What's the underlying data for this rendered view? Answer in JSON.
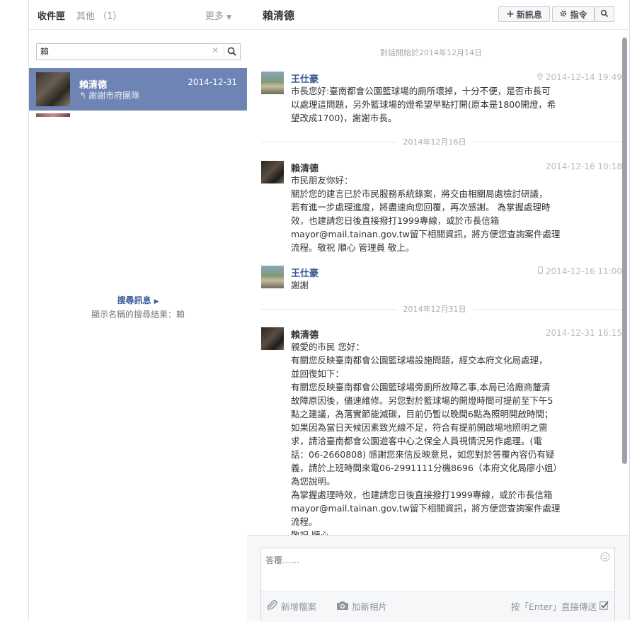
{
  "left_panel": {
    "tab_inbox": "收件匣",
    "tab_other": "其他 （1）",
    "more_label": "更多",
    "search_value": "賴",
    "conversations": [
      {
        "name": "賴清德",
        "date": "2014-12-31",
        "snippet": "謝謝市府團隊"
      }
    ],
    "search_more_label": "搜尋訊息",
    "search_result_text": "顯示名稱的搜尋結果：賴"
  },
  "header": {
    "title": "賴清德",
    "new_message_label": "新訊息",
    "actions_label": "指令"
  },
  "thread": {
    "start_text": "對話開始於2014年12月14日",
    "dividers": [
      "2014年12月16日",
      "2014年12月31日"
    ],
    "messages": [
      {
        "sender": "王仕豪",
        "time": "2014-12-14 19:49",
        "source_icon": "location-pin-icon",
        "lines": [
          "市長您好:臺南都會公園籃球場的廁所壞掉，十分不便，是否市長可",
          "以處理這問題，另外籃球場的燈希望早點打開(原本是1800開燈，希",
          "望改成1700)，謝謝市長。"
        ]
      },
      {
        "sender": "賴清德",
        "time": "2014-12-16 10:18",
        "lines": [
          "市民朋友你好：",
          "關於您的建言已於市民服務系統錄案，將交由相關局處檢討研議，",
          "若有進一步處理進度，將盡速向您回覆，再次感謝。 為掌握處理時",
          "效，也建請您日後直接撥打1999專線，或於市長信箱",
          "mayor@mail.tainan.gov.tw留下相關資訊，將方便您查詢案件處理",
          "流程。敬祝 順心 管理員 敬上。"
        ]
      },
      {
        "sender": "王仕豪",
        "time": "2014-12-16 11:00",
        "source_icon": "mobile-phone-icon",
        "lines": [
          "謝謝"
        ]
      },
      {
        "sender": "賴清德",
        "time": "2014-12-31 16:15",
        "lines": [
          "親愛的市民 您好：",
          "有關您反映臺南都會公園籃球場設施問題，經交本府文化局處理，",
          "並回復如下：",
          "有關您反映臺南都會公園籃球場旁廁所故障乙事,本局已洽廠商釐清",
          "故障原因後，儘速維修。另您對於籃球場的開燈時間可提前至下午5",
          "點之建議，為落實節能減碳，目前仍暫以晚間6點為照明開啟時間；",
          "如果因為當日天候因素致光線不足，符合有提前開啟場地照明之需",
          "求，請洽臺南都會公園遊客中心之保全人員視情況另作處理。(電",
          "話：06-2660808) 感謝您來信反映意見，如您對於答覆內容仍有疑",
          "義，請於上班時間來電06-2991111分機8696（本府文化局廖小姐）",
          "為您說明。",
          "為掌握處理時效，也建請您日後直接撥打1999專線，或於市長信箱",
          "mayor@mail.tainan.gov.tw留下相關資訊，將方便您查詢案件處理",
          "流程。",
          "敬祝 順心"
        ]
      }
    ]
  },
  "composer": {
    "placeholder": "答覆……",
    "add_file_label": "新增檔案",
    "add_photo_label": "加新相片",
    "enter_send_label": "按「Enter」直接傳送"
  },
  "colors": {
    "selected_conversation": "#6d84b4",
    "link_blue": "#3b5998"
  }
}
